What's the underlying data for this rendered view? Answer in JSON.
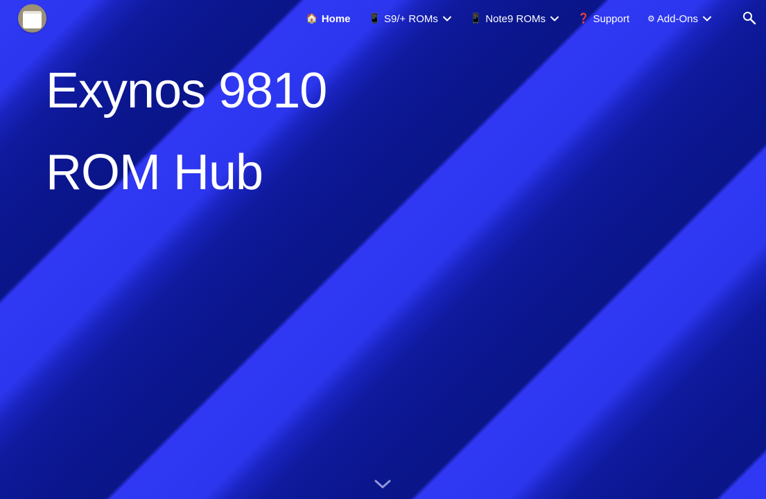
{
  "site": {
    "logo_icon": "site-logo-icon",
    "background_colors": [
      "#2e38f2",
      "#0c1796"
    ]
  },
  "nav": {
    "items": [
      {
        "emoji": "🏠",
        "label": "Home",
        "active": true,
        "has_dropdown": false
      },
      {
        "emoji": "📱",
        "label": "S9/+ ROMs",
        "active": false,
        "has_dropdown": true
      },
      {
        "emoji": "📱",
        "label": "Note9 ROMs",
        "active": false,
        "has_dropdown": true
      },
      {
        "emoji": "❓",
        "label": "Support",
        "active": false,
        "has_dropdown": false
      },
      {
        "emoji": "⚙",
        "label": "Add-Ons",
        "active": false,
        "has_dropdown": true
      }
    ],
    "search_icon": "search-icon"
  },
  "hero": {
    "line1": "Exynos 9810",
    "line2": "ROM Hub"
  },
  "scroll_icon": "chevron-down-icon"
}
